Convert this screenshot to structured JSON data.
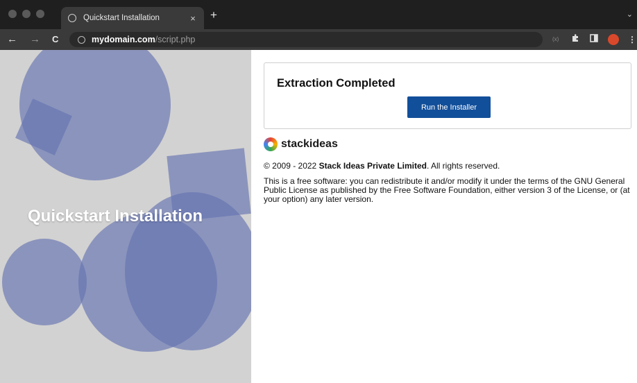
{
  "browser": {
    "tab": {
      "title": "Quickstart Installation",
      "close_glyph": "×"
    },
    "new_tab_glyph": "+",
    "tab_dropdown_glyph": "⌄",
    "nav": {
      "back_glyph": "←",
      "forward_glyph": "→",
      "reload_glyph": "C"
    },
    "url": {
      "host": "mydomain.com",
      "path": "/script.php"
    },
    "toolbar_icons": [
      "cast-icon",
      "extensions-icon",
      "sidepanel-icon",
      "avatar",
      "menu-icon"
    ],
    "ext_text": "(x)",
    "menu_glyph": "⋮"
  },
  "hero": {
    "title": "Quickstart Installation"
  },
  "card": {
    "title": "Extraction Completed",
    "button_label": "Run the Installer"
  },
  "brand": {
    "name": "stackideas"
  },
  "footer": {
    "copyright_prefix": "© 2009 - 2022 ",
    "company": "Stack Ideas Private Limited",
    "copyright_suffix": ". All rights reserved.",
    "license_text": "This is a free software: you can redistribute it and/or modify it under the terms of the GNU General Public License as published by the Free Software Foundation, either version 3 of the License, or (at your option) any later version."
  },
  "colors": {
    "accent": "#124f9a",
    "hero_shape": "#6673b0",
    "hero_background": "#d2d2d2"
  }
}
